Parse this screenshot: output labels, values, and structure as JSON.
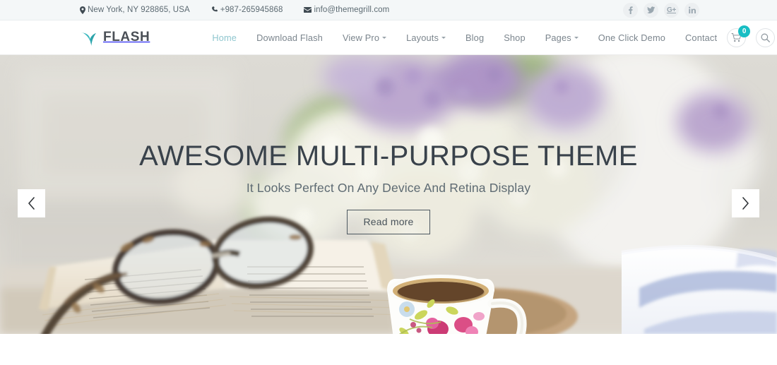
{
  "topbar": {
    "address": "New York, NY 928865, USA",
    "address_icon": "map-marker-icon",
    "phone": "+987-265945868",
    "phone_icon": "phone-icon",
    "email": "info@themegrill.com",
    "email_icon": "envelope-icon",
    "social": [
      {
        "name": "facebook",
        "label": "f"
      },
      {
        "name": "twitter",
        "label": ""
      },
      {
        "name": "google-plus",
        "label": "G+"
      },
      {
        "name": "linkedin",
        "label": "in"
      }
    ]
  },
  "brand": {
    "name": "FLASH",
    "mark": "bird-logo-icon",
    "accent_color": "#3bb8bf"
  },
  "nav": {
    "items": [
      {
        "label": "Home",
        "active": true,
        "dropdown": false
      },
      {
        "label": "Download Flash",
        "active": false,
        "dropdown": false
      },
      {
        "label": "View Pro",
        "active": false,
        "dropdown": true
      },
      {
        "label": "Layouts",
        "active": false,
        "dropdown": true
      },
      {
        "label": "Blog",
        "active": false,
        "dropdown": false
      },
      {
        "label": "Shop",
        "active": false,
        "dropdown": false
      },
      {
        "label": "Pages",
        "active": false,
        "dropdown": true
      },
      {
        "label": "One Click Demo",
        "active": false,
        "dropdown": false
      },
      {
        "label": "Contact",
        "active": false,
        "dropdown": false
      }
    ],
    "cart": {
      "icon": "shopping-cart-icon",
      "count": "0",
      "badge_color": "#18bec4"
    },
    "search": {
      "icon": "search-icon"
    }
  },
  "hero": {
    "title": "AWESOME MULTI-PURPOSE THEME",
    "subtitle": "It Looks Perfect On Any Device And Retina Display",
    "button_label": "Read more",
    "prev_label": "‹",
    "next_label": "›",
    "scene": "blurred lilac and white flowers above an open book with tortoiseshell glasses, a floral teacup of coffee on a wooden saucer, and a blue-striped cloth"
  }
}
